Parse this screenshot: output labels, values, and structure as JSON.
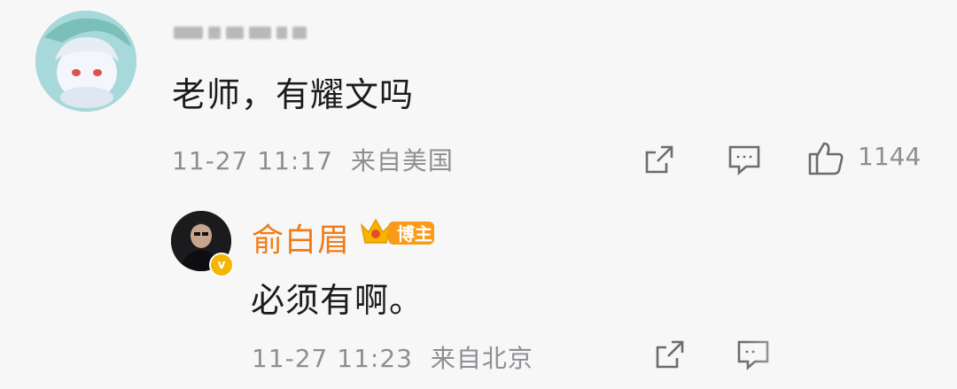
{
  "comment": {
    "text": "老师，有耀文吗",
    "time": "11-27 11:17",
    "location": "来自美国",
    "like_count": "1144"
  },
  "reply": {
    "author": "俞白眉",
    "badge": "博主",
    "text": "必须有啊。",
    "time": "11-27 11:23",
    "location": "来自北京"
  },
  "icons": {
    "share": "share-icon",
    "comment": "comment-icon",
    "like": "thumbs-up-icon",
    "verified": "verified-v-icon",
    "crown": "crown-icon"
  },
  "colors": {
    "author": "#f07b17",
    "meta": "#8e8e93",
    "background": "#f7f7f8"
  }
}
